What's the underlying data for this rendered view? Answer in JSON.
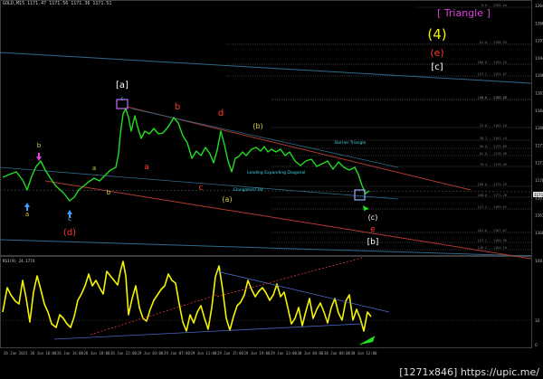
{
  "header": {
    "symbol": "GOLD,M15",
    "ohlc": "1171.47 1171.56 1171.36 1171.51"
  },
  "wave_title": {
    "pattern": "[ Triangle ]",
    "degree": "(4)",
    "wave": "(e)",
    "sub": "[c]"
  },
  "colors": {
    "background": "#000000",
    "price": "#22dd22",
    "rsi": "#f5f500",
    "triangle_lines": "#2d6a8a",
    "channel_red": "#b03a30",
    "fib_levels": "#666666",
    "magenta_title": "#e040e0",
    "wave_red": "#ff3a2a",
    "wave_yellow": "#d8d040",
    "wave_cyan": "#40d8e0",
    "wave_white": "#ffffff",
    "wave_orange": "#e08030"
  },
  "wave_labels": {
    "a_left": "a",
    "b_left": "b",
    "d_paren": "(d)",
    "c_cyan": "c",
    "a_yellow": "a",
    "b_yellow": "b",
    "c_top": "c",
    "a_bracket": "[a]",
    "b_red": "b",
    "a_red": "a",
    "c_red": "c",
    "d_red": "d",
    "b_paren": "(b)",
    "a_paren": "(a)",
    "barrier_triangle": "Barrier Triangle",
    "leading_diagonal": "Leading Expanding Diagonal",
    "elongated_flat": "Elongated Flat",
    "c_paren": "(c)",
    "e_red": "e",
    "b_bracket": "[b]"
  },
  "price_axis": {
    "labels": [
      "1204.10",
      "1200.75",
      "1197.40",
      "1194.05",
      "1190.70",
      "1187.35",
      "1184.00",
      "1180.65",
      "1177.30",
      "1173.95",
      "1170.60",
      "1167.25",
      "1163.90",
      "1160.55"
    ],
    "current": "1171.51"
  },
  "fib_labels": [
    "0.0 - 1205.04",
    "61.8 - 1198.55",
    "100.0 - 1194.25",
    "127.2 - 1191.87",
    "0.0 - 1187.28",
    "100.0 - 1186.37",
    "23.6 - 1183.44",
    "38.2 - 1181.44",
    "50.0 - 1179.89",
    "61.8 - 1178.36",
    "76.4 - 1176.45",
    "100.0 - 1173.25",
    "100.0 - 1171.26",
    "127.2 - 1169.61",
    "161.8 - 1167.07",
    "127.2 - 1165.36",
    "138.2 - 1164.10"
  ],
  "rsi": {
    "label": "RSI(9) 24.1774",
    "axis": [
      "100",
      "32",
      "0"
    ]
  },
  "time_axis": [
    "26 Jun 2015",
    "26 Jun 10:00",
    "26 Jun 14:00",
    "26 Jun 18:00",
    "26 Jun 22:00",
    "29 Jun 03:00",
    "29 Jun 07:00",
    "29 Jun 11:00",
    "29 Jun 15:00",
    "29 Jun 19:00",
    "29 Jun 23:00",
    "30 Jun 04:00",
    "30 Jun 08:00",
    "30 Jun 12:00"
  ],
  "watermark": "[1271x846] https://upic.me/"
}
